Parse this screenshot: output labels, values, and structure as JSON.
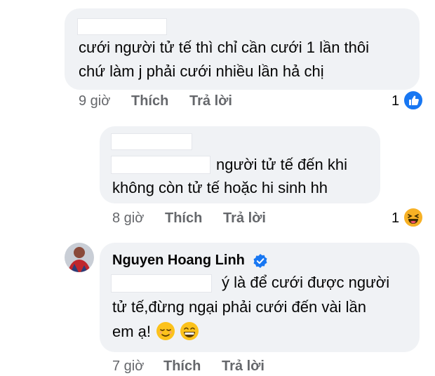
{
  "comments": [
    {
      "text_lines": [
        "cưới người tử tế thì chỉ cần cưới 1 lần thôi",
        "chứ làm j phải cưới nhiều lần hả chị"
      ],
      "time": "9 giờ",
      "like_label": "Thích",
      "reply_label": "Trả lời",
      "reaction_count": "1",
      "reaction": "like-icon"
    },
    {
      "text_lines": [
        "người tử tế đến khi",
        "không còn tử tế hoặc hi sinh hh"
      ],
      "time": "8 giờ",
      "like_label": "Thích",
      "reply_label": "Trả lời",
      "reaction_count": "1",
      "reaction": "haha-icon"
    },
    {
      "author": "Nguyen Hoang Linh",
      "verified": "verified-badge-icon",
      "text_lines": [
        "ý là để cưới được người",
        "tử tế,đừng ngại phải cưới đến vài lần",
        "em ạ!"
      ],
      "emojis": [
        "relieved-face-emoji",
        "grinning-face-emoji"
      ],
      "time": "7 giờ",
      "like_label": "Thích",
      "reply_label": "Trả lời"
    }
  ],
  "colors": {
    "bubble": "#f0f2f5",
    "meta": "#65676b",
    "like_blue": "#1877f2",
    "verified_blue": "#1877f2",
    "haha_yellow": "#f7b125"
  }
}
